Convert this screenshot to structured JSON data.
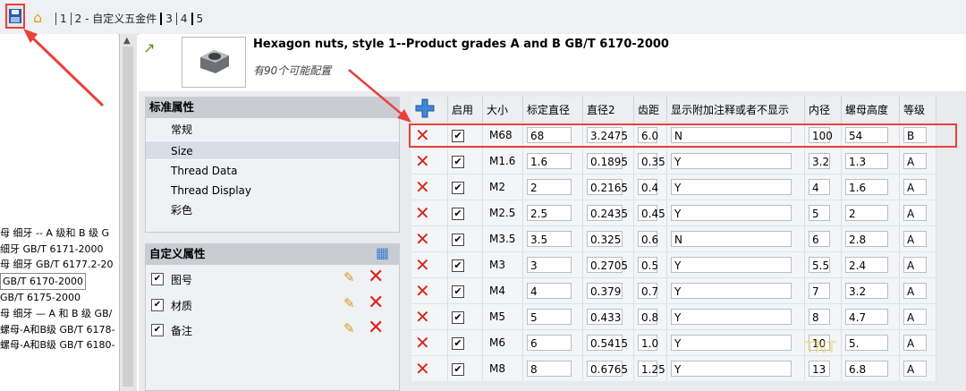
{
  "toolbar": {
    "tabs": [
      "1",
      "2 - 自定义五金件",
      "3",
      "4",
      "5"
    ]
  },
  "product": {
    "title": "Hexagon nuts, style 1--Product grades A and B GB/T 6170-2000",
    "subtitle": "有90个可能配置"
  },
  "left_list": [
    "母 细牙 -- A 级和 B 级 G",
    "细牙 GB/T 6171-2000",
    "母 细牙 GB/T 6177.2-20",
    "GB/T 6170-2000",
    "GB/T 6175-2000",
    "母 细牙 — A 和 B 级 GB/",
    "螺母-A和B级 GB/T 6178-",
    "螺母-A和B级 GB/T 6180-"
  ],
  "standard_props": {
    "header": "标准属性",
    "items": [
      "常规",
      "Size",
      "Thread Data",
      "Thread Display",
      "彩色"
    ],
    "active": "Size"
  },
  "custom_props": {
    "header": "自定义属性",
    "items": [
      "图号",
      "材质",
      "备注"
    ]
  },
  "table": {
    "columns": [
      "启用",
      "大小",
      "标定直径",
      "直径2",
      "齿距",
      "显示附加注释或者不显示",
      "内径",
      "螺母高度",
      "等级"
    ],
    "rows": [
      [
        "M68",
        "68",
        "3.2475",
        "6.0",
        "N",
        "100",
        "54",
        "B"
      ],
      [
        "M1.6",
        "1.6",
        "0.1895",
        "0.35",
        "Y",
        "3.2",
        "1.3",
        "A"
      ],
      [
        "M2",
        "2",
        "0.2165",
        "0.4",
        "Y",
        "4",
        "1.6",
        "A"
      ],
      [
        "M2.5",
        "2.5",
        "0.2435",
        "0.45",
        "Y",
        "5",
        "2",
        "A"
      ],
      [
        "M3.5",
        "3.5",
        "0.325",
        "0.6",
        "N",
        "6",
        "2.8",
        "A"
      ],
      [
        "M3",
        "3",
        "0.2705",
        "0.5",
        "Y",
        "5.5",
        "2.4",
        "A"
      ],
      [
        "M4",
        "4",
        "0.379",
        "0.7",
        "Y",
        "7",
        "3.2",
        "A"
      ],
      [
        "M5",
        "5",
        "0.433",
        "0.8",
        "Y",
        "8",
        "4.7",
        "A"
      ],
      [
        "M6",
        "6",
        "0.5415",
        "1.0",
        "Y",
        "10",
        "5.",
        "A"
      ],
      [
        "M8",
        "8",
        "0.6765",
        "1.25",
        "Y",
        "13",
        "6.8",
        "A"
      ]
    ]
  },
  "colors": {
    "accent_red": "#e8413a",
    "delete_red": "#d42a1f"
  }
}
